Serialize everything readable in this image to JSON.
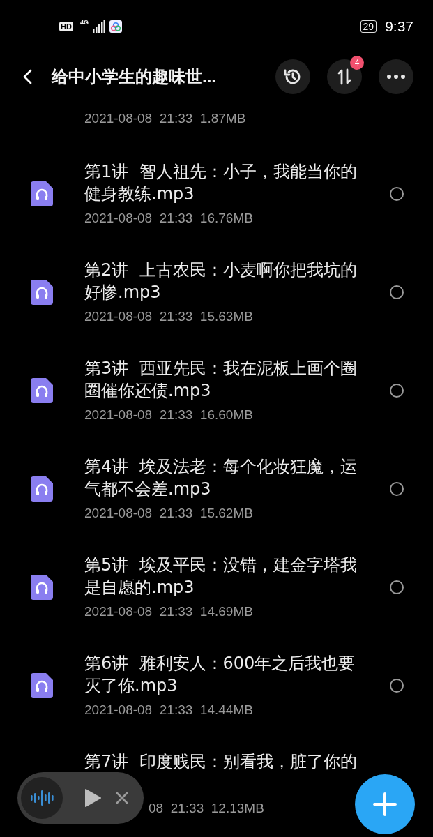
{
  "status_bar": {
    "left_badges": [
      "HD",
      "4G"
    ],
    "battery": "29",
    "time": "9:37"
  },
  "header": {
    "title": "给中小学生的趣味世...",
    "badge": "4"
  },
  "files": [
    {
      "kind": "meta_only",
      "meta": "2021-08-08  21:33  1.87MB"
    },
    {
      "kind": "file",
      "name": "第1讲  智人祖先：小子，我能当你的健身教练.mp3",
      "meta": "2021-08-08  21:33  16.76MB",
      "selected": false
    },
    {
      "kind": "file",
      "name": "第2讲  上古农民：小麦啊你把我坑的好惨.mp3",
      "meta": "2021-08-08  21:33  15.63MB",
      "selected": false
    },
    {
      "kind": "file",
      "name": "第3讲  西亚先民：我在泥板上画个圈圈催你还债.mp3",
      "meta": "2021-08-08  21:33  16.60MB",
      "selected": false
    },
    {
      "kind": "file",
      "name": "第4讲  埃及法老：每个化妆狂魔，运气都不会差.mp3",
      "meta": "2021-08-08  21:33  15.62MB",
      "selected": false
    },
    {
      "kind": "file",
      "name": "第5讲  埃及平民：没错，建金字塔我是自愿的.mp3",
      "meta": "2021-08-08  21:33  14.69MB",
      "selected": false
    },
    {
      "kind": "file",
      "name": "第6讲  雅利安人：600年之后我也要灭了你.mp3",
      "meta": "2021-08-08  21:33  14.44MB",
      "selected": false
    },
    {
      "kind": "covered",
      "name": "第7讲  印度贱民：别看我，脏了你的",
      "meta": "08  21:33  12.13MB"
    }
  ]
}
